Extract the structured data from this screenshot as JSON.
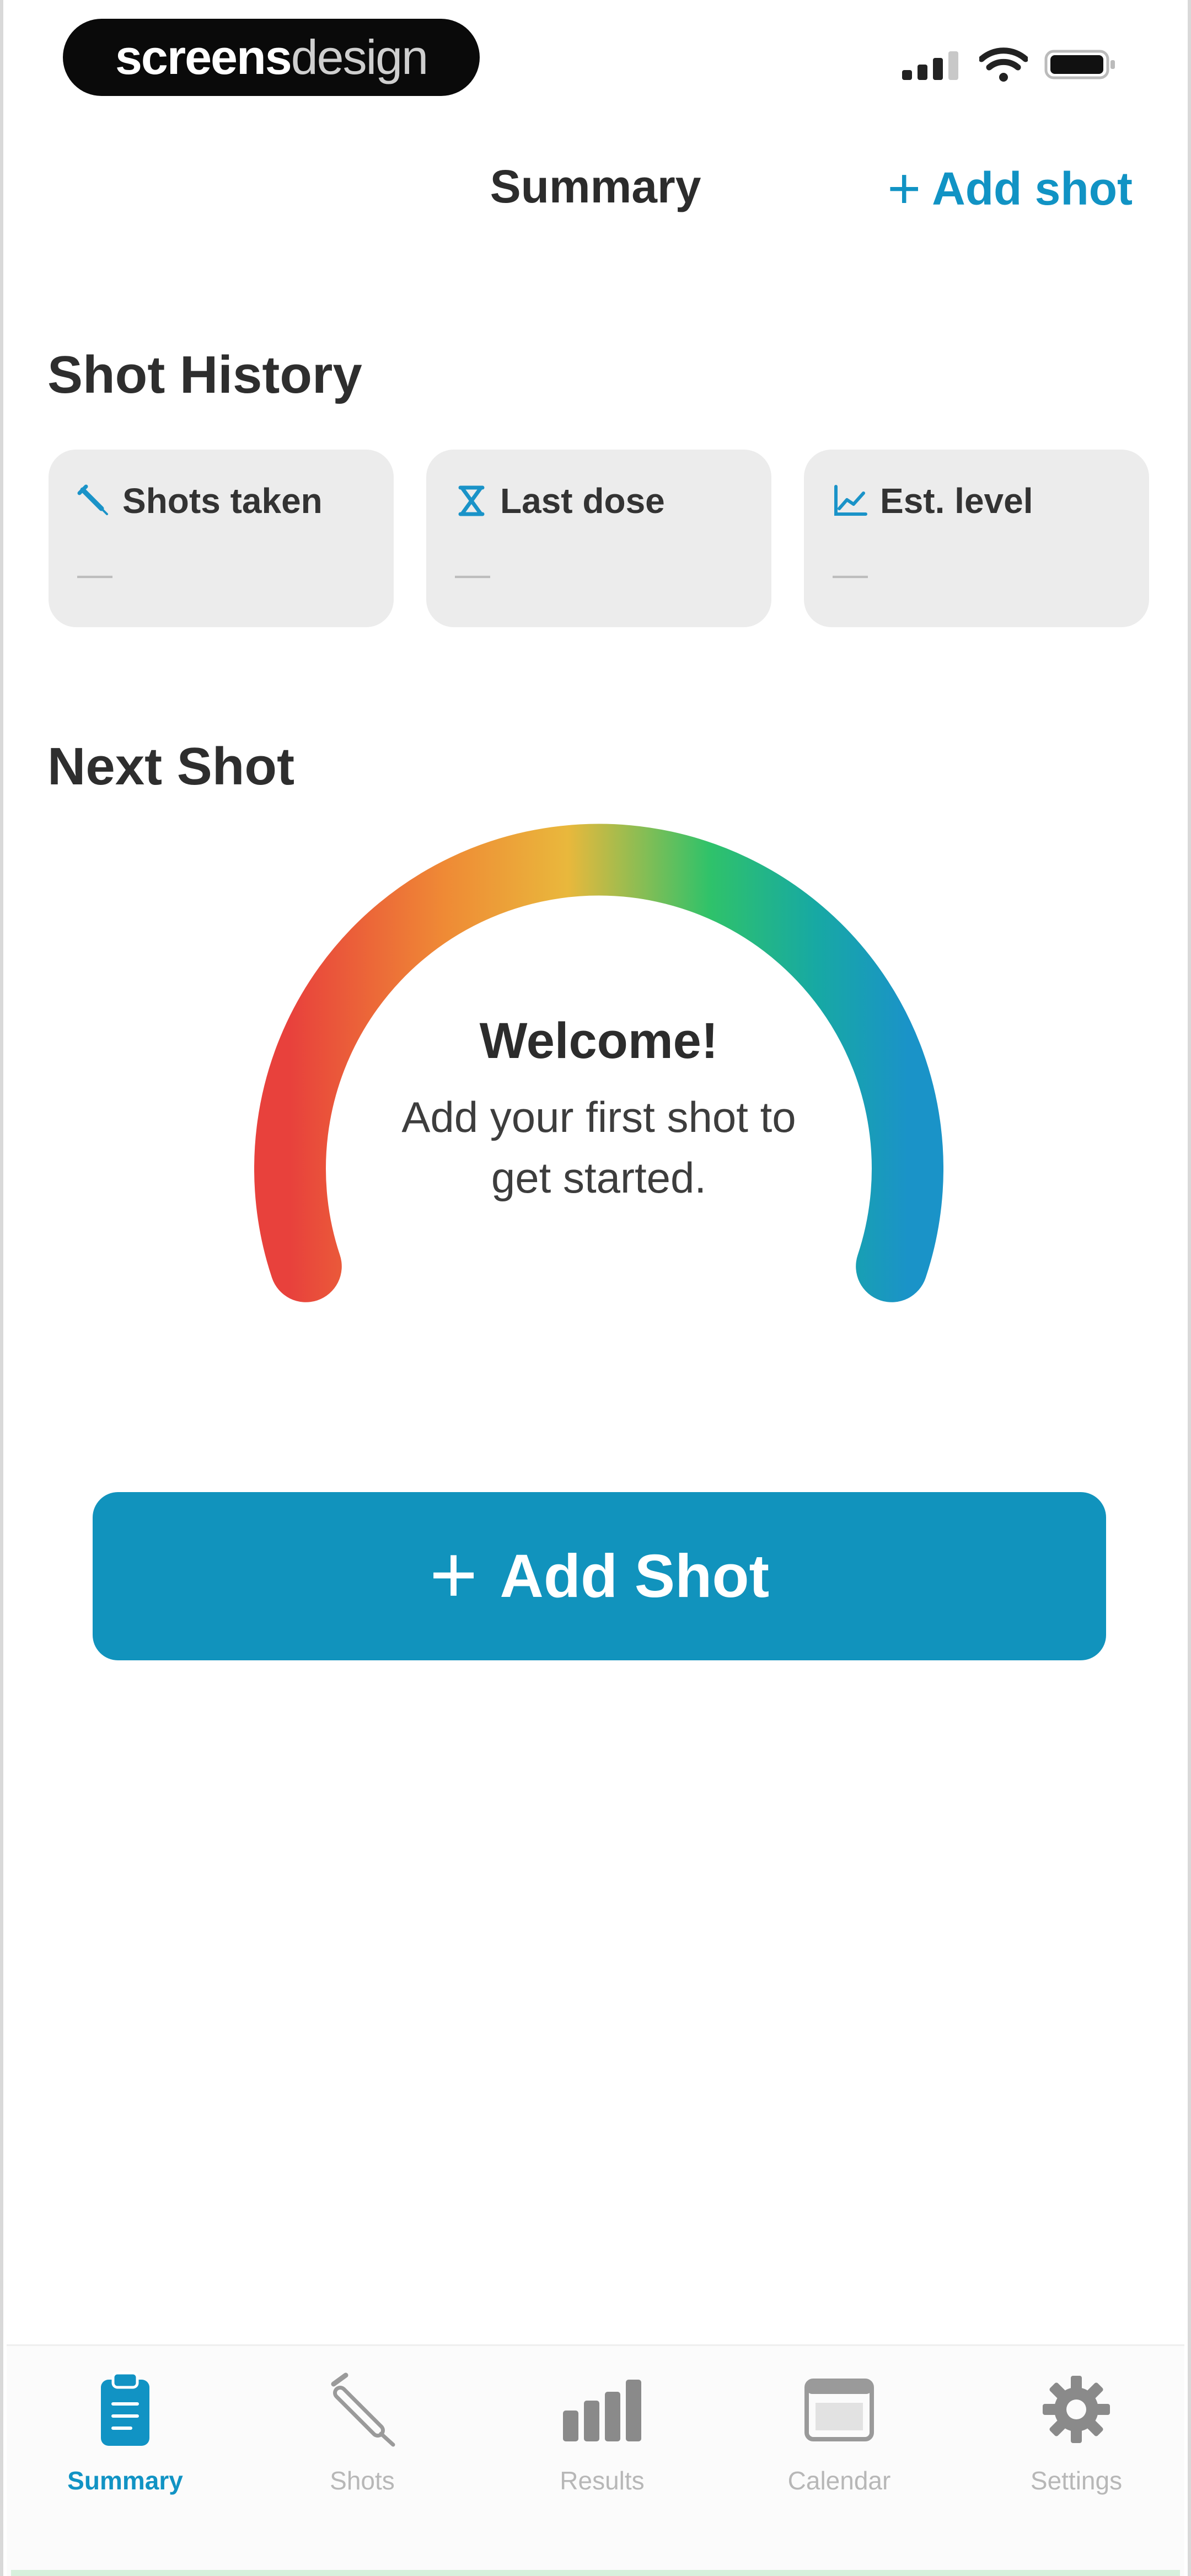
{
  "status_bar": {
    "watermark_bold": "screens",
    "watermark_light": "design"
  },
  "nav": {
    "title": "Summary",
    "add_label": "Add shot"
  },
  "history": {
    "title": "Shot History",
    "cards": [
      {
        "label": "Shots taken",
        "value": "—",
        "icon": "syringe-icon"
      },
      {
        "label": "Last dose",
        "value": "—",
        "icon": "hourglass-icon"
      },
      {
        "label": "Est. level",
        "value": "—",
        "icon": "chart-icon"
      }
    ]
  },
  "next_shot": {
    "title": "Next Shot",
    "welcome": "Welcome!",
    "subtitle_line1": "Add your first shot to",
    "subtitle_line2": "get started."
  },
  "main_button": {
    "label": "Add Shot"
  },
  "tabs": [
    {
      "label": "Summary",
      "icon": "clipboard-icon",
      "active": true
    },
    {
      "label": "Shots",
      "icon": "syringe-icon",
      "active": false
    },
    {
      "label": "Results",
      "icon": "bar-chart-icon",
      "active": false
    },
    {
      "label": "Calendar",
      "icon": "calendar-icon",
      "active": false
    },
    {
      "label": "Settings",
      "icon": "gear-icon",
      "active": false
    }
  ],
  "colors": {
    "accent": "#1193c4",
    "button": "#1193bd",
    "gauge_red": "#e8413c",
    "gauge_orange": "#ef8a35",
    "gauge_yellow": "#e9b83c",
    "gauge_green": "#2fc26a",
    "gauge_teal": "#17a9a3",
    "gauge_blue": "#1a93c8"
  }
}
